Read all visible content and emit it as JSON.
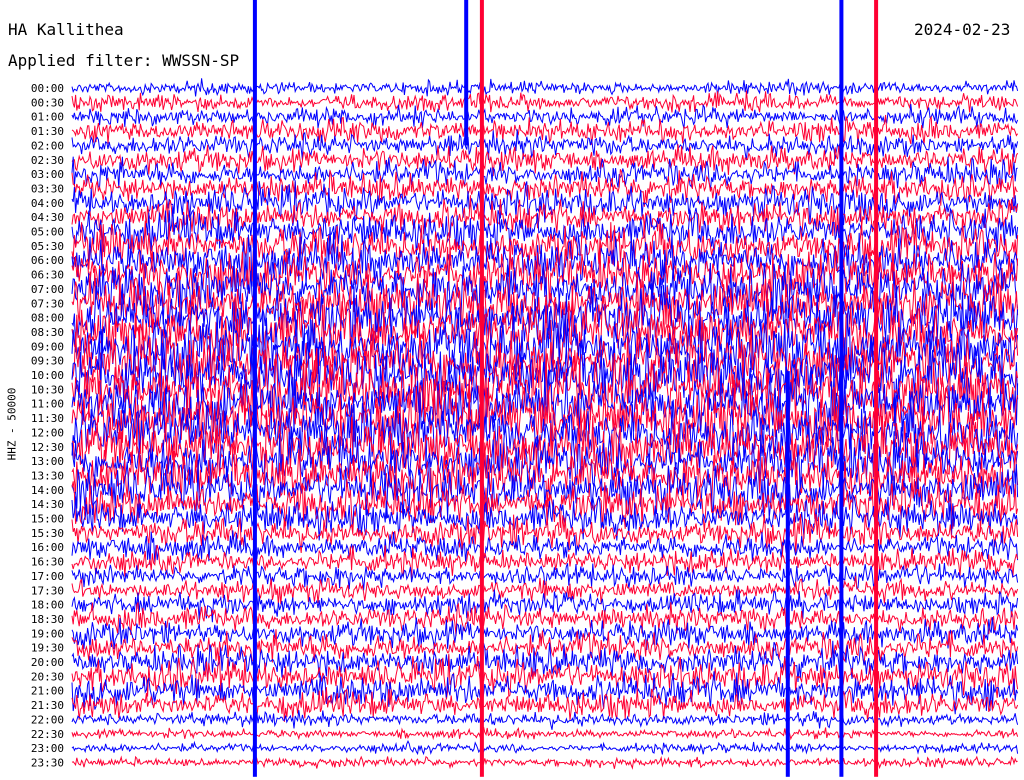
{
  "header": {
    "station": "HA Kallithea",
    "date": "2024-02-23",
    "filter": "Applied filter: WWSSN-SP"
  },
  "channel_label": "HHZ - 50000",
  "colors": {
    "trace_a": "#0000ff",
    "trace_b": "#ff0033",
    "background": "#ffffff"
  },
  "chart_data": {
    "type": "line",
    "title": "HA Kallithea",
    "subtitle": "Applied filter: WWSSN-SP",
    "ylabel": "HHZ - 50000",
    "xlabel": "",
    "row_labels": [
      "00:00",
      "00:30",
      "01:00",
      "01:30",
      "02:00",
      "02:30",
      "03:00",
      "03:30",
      "04:00",
      "04:30",
      "05:00",
      "05:30",
      "06:00",
      "06:30",
      "07:00",
      "07:30",
      "08:00",
      "08:30",
      "09:00",
      "09:30",
      "10:00",
      "10:30",
      "11:00",
      "11:30",
      "12:00",
      "12:30",
      "13:00",
      "13:30",
      "14:00",
      "14:30",
      "15:00",
      "15:30",
      "16:00",
      "16:30",
      "17:00",
      "17:30",
      "18:00",
      "18:30",
      "19:00",
      "19:30",
      "20:00",
      "20:30",
      "21:00",
      "21:30",
      "22:00",
      "22:30",
      "23:00",
      "23:30"
    ],
    "row_colors": [
      "#0000ff",
      "#ff0033"
    ],
    "row_amplitude": [
      0.6,
      0.7,
      0.8,
      1.0,
      1.0,
      1.1,
      1.1,
      1.2,
      1.4,
      1.4,
      1.6,
      1.8,
      2.0,
      2.1,
      2.2,
      2.3,
      2.4,
      2.5,
      2.6,
      2.6,
      2.7,
      2.7,
      2.6,
      2.6,
      2.5,
      2.4,
      2.3,
      2.2,
      2.0,
      1.8,
      1.5,
      1.3,
      1.1,
      1.0,
      0.9,
      0.9,
      1.0,
      1.1,
      1.1,
      1.2,
      1.3,
      1.4,
      1.4,
      1.1,
      0.6,
      0.4,
      0.4,
      0.4
    ],
    "spikes": [
      {
        "minute_in_row": 5.8,
        "row": 0,
        "rows_spanned": 48,
        "color": "#0000ff"
      },
      {
        "minute_in_row": 13.0,
        "row": 0,
        "rows_spanned": 48,
        "color": "#ff0033"
      },
      {
        "minute_in_row": 12.5,
        "row": 0,
        "rows_spanned": 4,
        "color": "#0000ff"
      },
      {
        "minute_in_row": 24.4,
        "row": 0,
        "rows_spanned": 48,
        "color": "#0000ff"
      },
      {
        "minute_in_row": 25.5,
        "row": 0,
        "rows_spanned": 48,
        "color": "#ff0033"
      },
      {
        "minute_in_row": 22.7,
        "row": 26,
        "rows_spanned": 22,
        "color": "#0000ff"
      }
    ],
    "x_minutes_per_row": 30,
    "ylim_rows": [
      0,
      48
    ]
  }
}
